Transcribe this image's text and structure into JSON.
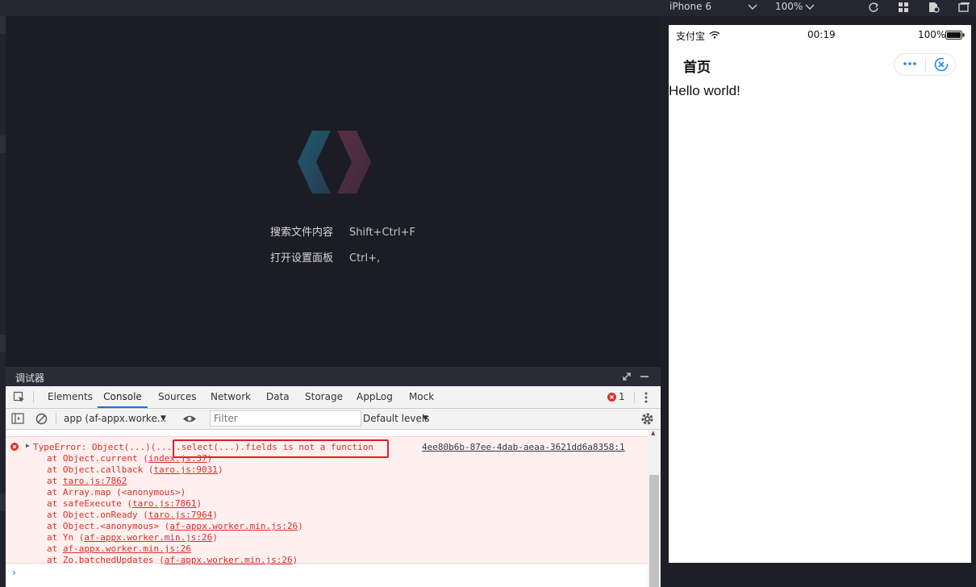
{
  "toolbar": {
    "device": "iPhone 6",
    "zoom": "100%"
  },
  "editor": {
    "shortcuts": [
      {
        "label": "搜索文件内容",
        "keys": "Shift+Ctrl+F"
      },
      {
        "label": "打开设置面板",
        "keys": "Ctrl+,"
      }
    ]
  },
  "debugger": {
    "title": "调试器",
    "tabs": [
      "Elements",
      "Console",
      "Sources",
      "Network",
      "Data",
      "Storage",
      "AppLog",
      "Mock"
    ],
    "active_tab": "Console",
    "error_count": "1",
    "context": "app (af-appx.worke...",
    "filter_placeholder": "Filter",
    "levels": "Default levels"
  },
  "console": {
    "error_head": "TypeError: Object(...)(...",
    "error_highlight": ".select(...).fields is not a function",
    "error_source": "4ee80b6b-87ee-4dab-aeaa-3621dd6a8358:1",
    "stack": [
      {
        "prefix": "at Object.current (",
        "link": "index.js:37",
        "suffix": ")"
      },
      {
        "prefix": "at Object.callback (",
        "link": "taro.js:9031",
        "suffix": ")"
      },
      {
        "prefix": "at ",
        "link": "taro.js:7862",
        "suffix": ""
      },
      {
        "prefix": "at Array.map (<anonymous>)",
        "link": "",
        "suffix": ""
      },
      {
        "prefix": "at safeExecute (",
        "link": "taro.js:7861",
        "suffix": ")"
      },
      {
        "prefix": "at Object.onReady (",
        "link": "taro.js:7964",
        "suffix": ")"
      },
      {
        "prefix": "at Object.<anonymous> (",
        "link": "af-appx.worker.min.js:26",
        "suffix": ")"
      },
      {
        "prefix": "at Yn (",
        "link": "af-appx.worker.min.js:26",
        "suffix": ")"
      },
      {
        "prefix": "at ",
        "link": "af-appx.worker.min.js:26",
        "suffix": ""
      },
      {
        "prefix": "at Zo.batchedUpdates (",
        "link": "af-appx.worker.min.js:26",
        "suffix": ")"
      }
    ],
    "prompt": "›"
  },
  "phone": {
    "carrier": "支付宝",
    "time": "00:19",
    "battery": "100%",
    "page_title": "首页",
    "content": "Hello world!"
  },
  "colors": {
    "accent": "#1a73e8",
    "error": "#d93025",
    "capsule_blue": "#1b8bf5"
  },
  "icons": [
    "chevron-down-icon",
    "refresh-icon",
    "grid-icon",
    "file-settings-icon",
    "window-icon",
    "expand-icon",
    "minimize-icon",
    "inspect-icon",
    "clear-icon",
    "eye-icon",
    "gear-icon",
    "more-icon",
    "error-icon",
    "wifi-icon",
    "battery-icon",
    "close-circle-icon"
  ]
}
